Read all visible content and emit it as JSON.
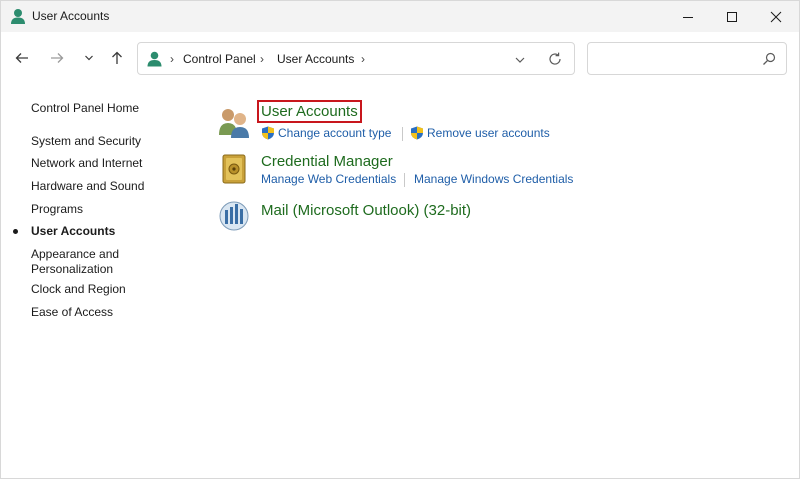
{
  "window": {
    "title": "User Accounts"
  },
  "navigation": {
    "breadcrumbs": [
      "Control Panel",
      "User Accounts"
    ],
    "separator": "›",
    "search_placeholder": ""
  },
  "sidebar": {
    "items": [
      {
        "label": "Control Panel Home",
        "active": false
      },
      {
        "label": "System and Security",
        "active": false
      },
      {
        "label": "Network and Internet",
        "active": false
      },
      {
        "label": "Hardware and Sound",
        "active": false
      },
      {
        "label": "Programs",
        "active": false
      },
      {
        "label": "User Accounts",
        "active": true
      },
      {
        "label": "Appearance and",
        "active": false
      },
      {
        "label": "Personalization",
        "active": false
      },
      {
        "label": "Clock and Region",
        "active": false
      },
      {
        "label": "Ease of Access",
        "active": false
      }
    ]
  },
  "main": {
    "categories": [
      {
        "title": "User Accounts",
        "icon": "users-icon",
        "highlighted": true,
        "tasks": [
          "Change account type",
          "Remove user accounts"
        ]
      },
      {
        "title": "Credential Manager",
        "icon": "vault-icon",
        "highlighted": false,
        "tasks": [
          "Manage Web Credentials",
          "Manage Windows Credentials"
        ]
      },
      {
        "title": "Mail (Microsoft Outlook) (32-bit)",
        "icon": "mail-icon",
        "highlighted": false,
        "tasks": []
      }
    ]
  },
  "colors": {
    "category_title": "#1e6b1e",
    "task_link": "#1f5ea8",
    "highlight_border": "#c8171d",
    "titlebar_bg": "#f3f3f3"
  }
}
